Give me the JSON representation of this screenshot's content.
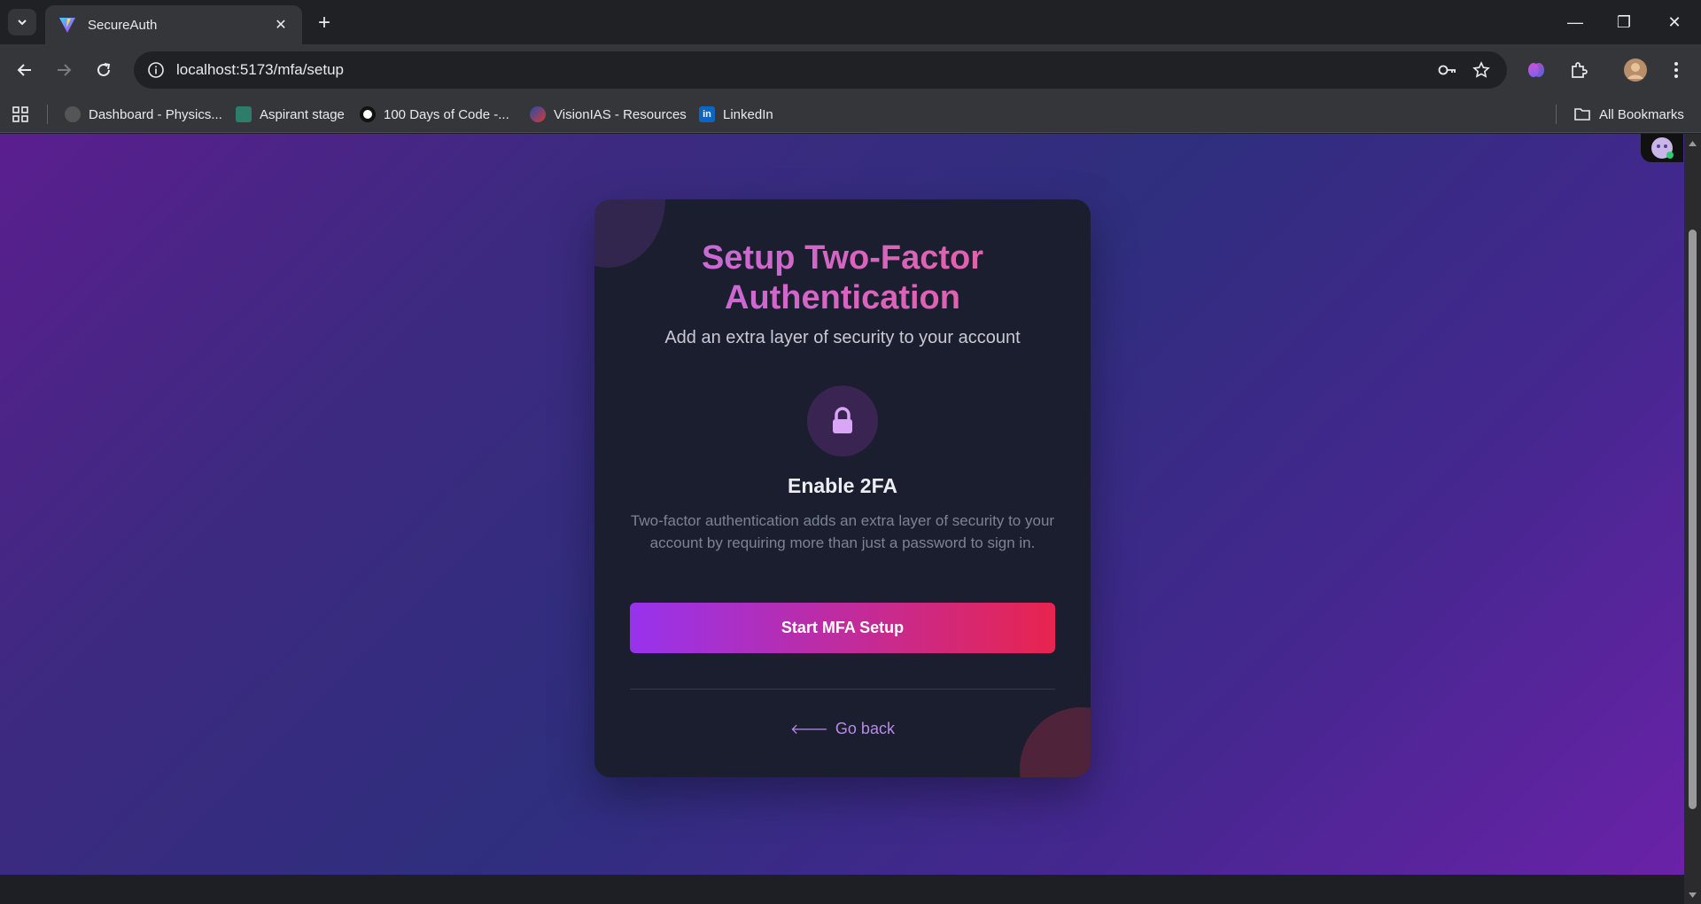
{
  "browser": {
    "tab_title": "SecureAuth",
    "tab_close": "✕",
    "new_tab": "+",
    "url": "localhost:5173/mfa/setup",
    "window_controls": {
      "minimize": "—",
      "restore": "❐",
      "close": "✕"
    }
  },
  "bookmarks": [
    {
      "label": "Dashboard - Physics...",
      "icon": "physics-favicon",
      "color": "#444444"
    },
    {
      "label": "Aspirant stage",
      "icon": "aspirant-favicon",
      "color": "#2e7d6a"
    },
    {
      "label": "100 Days of Code -...",
      "icon": "code-favicon",
      "color": "#ffffff"
    },
    {
      "label": "VisionIAS - Resources",
      "icon": "visionias-favicon",
      "color": "#d93838"
    },
    {
      "label": "LinkedIn",
      "icon": "linkedin-favicon",
      "color": "#0a66c2"
    }
  ],
  "all_bookmarks": "All Bookmarks",
  "page": {
    "title": "Setup Two-Factor Authentication",
    "subtitle": "Add an extra layer of security to your account",
    "lock_icon": "lock-icon",
    "enable_title": "Enable 2FA",
    "description": "Two-factor authentication adds an extra layer of security to your account by requiring more than just a password to sign in.",
    "start_button": "Start MFA Setup",
    "back_arrow": "🡐",
    "back_link": "Go back"
  },
  "colors": {
    "accent_purple": "#9733ee",
    "accent_red": "#e8244f",
    "card_bg": "#1a1e2e",
    "link": "#b88be6"
  }
}
